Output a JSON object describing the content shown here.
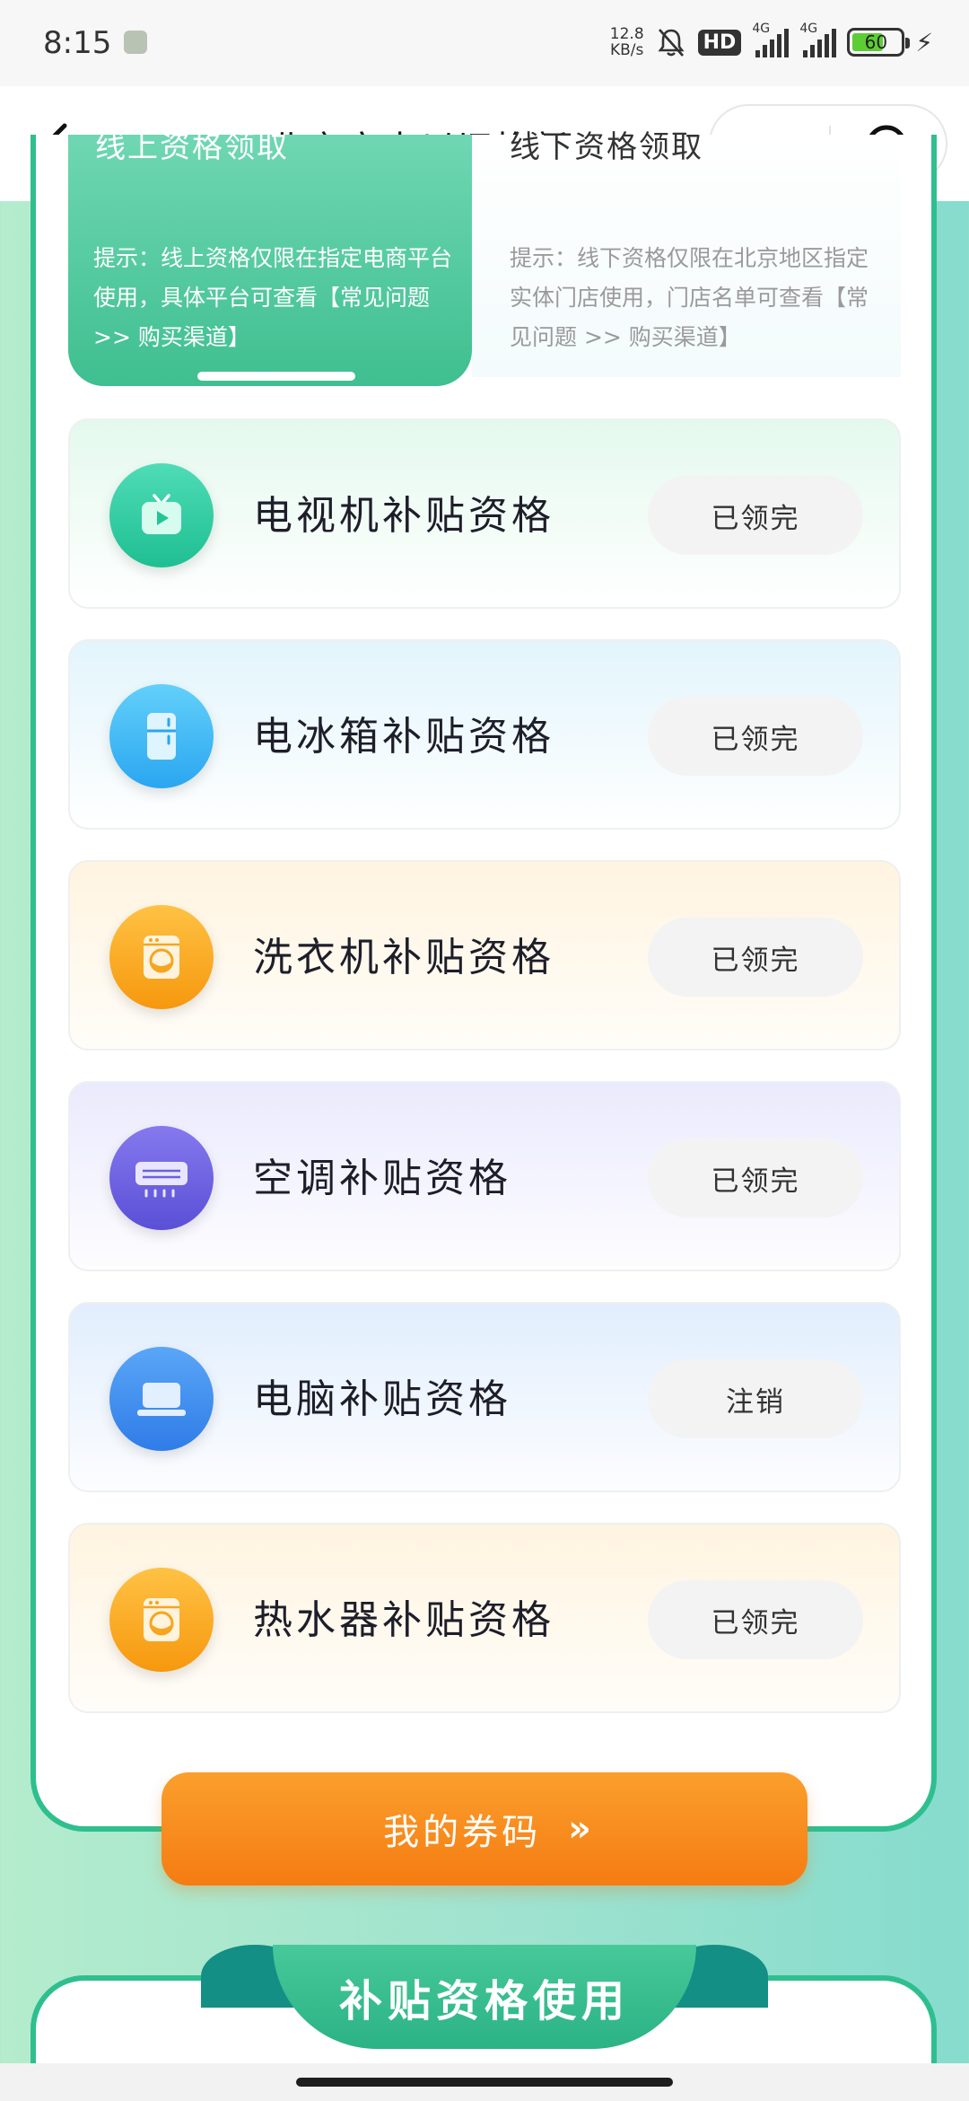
{
  "status_bar": {
    "time": "8:15",
    "net_speed_value": "12.8",
    "net_speed_unit": "KB/s",
    "hd_label": "HD",
    "signal1_label": "4G",
    "signal2_label": "4G",
    "battery": "60"
  },
  "nav": {
    "title": "北京家电以旧换新…"
  },
  "tabs": {
    "online": {
      "title": "线上资格领取",
      "desc": "提示：线上资格仅限在指定电商平台使用，具体平台可查看【常见问题 >> 购买渠道】"
    },
    "offline": {
      "title": "线下资格领取",
      "desc": "提示：线下资格仅限在北京地区指定实体门店使用，门店名单可查看【常见问题 >> 购买渠道】"
    }
  },
  "items": [
    {
      "label": "电视机补贴资格",
      "button": "已领完",
      "icon": "tv-icon"
    },
    {
      "label": "电冰箱补贴资格",
      "button": "已领完",
      "icon": "fridge-icon"
    },
    {
      "label": "洗衣机补贴资格",
      "button": "已领完",
      "icon": "washing-machine-icon"
    },
    {
      "label": "空调补贴资格",
      "button": "已领完",
      "icon": "air-conditioner-icon"
    },
    {
      "label": "电脑补贴资格",
      "button": "注销",
      "icon": "laptop-icon"
    },
    {
      "label": "热水器补贴资格",
      "button": "已领完",
      "icon": "water-heater-icon"
    }
  ],
  "coupon_button": {
    "label": "我的券码",
    "arrow": "»"
  },
  "bottom_section": {
    "title": "补贴资格使用"
  },
  "colors": {
    "accent_green": "#2fbf8f",
    "orange": "#f57c12",
    "tv_icon": "#2cc9a0",
    "fridge_icon": "#3cb6f2",
    "washer_icon": "#f8a416",
    "ac_icon": "#6b62e0",
    "laptop_icon": "#3f8cf0"
  }
}
